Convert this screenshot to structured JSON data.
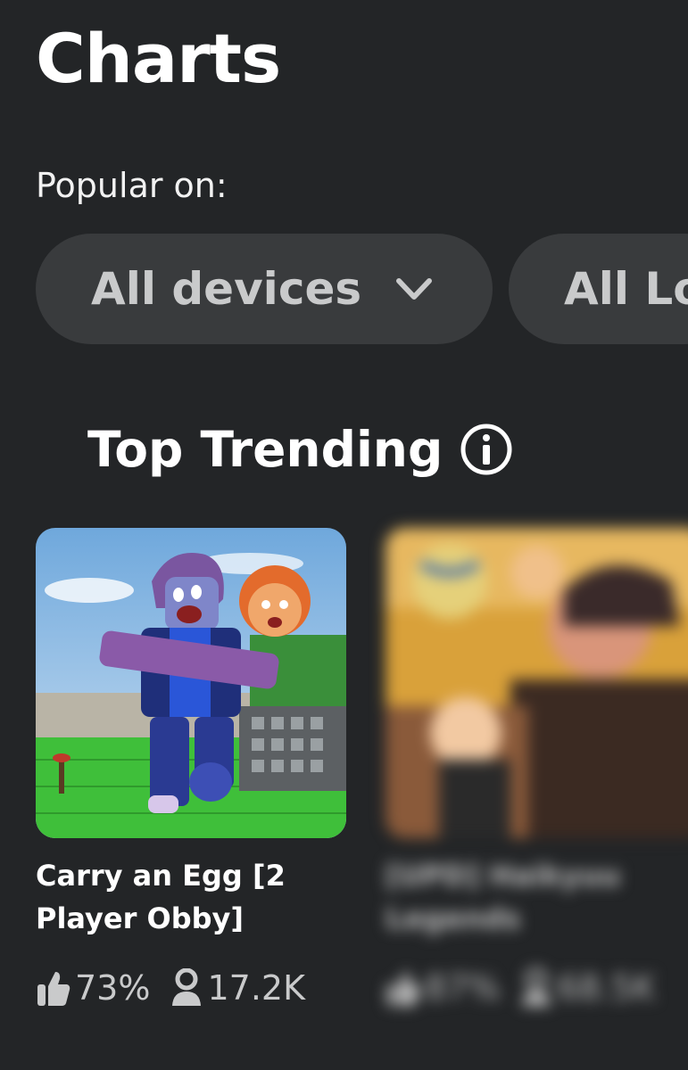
{
  "header": {
    "title": "Charts",
    "popular_label": "Popular on:"
  },
  "filters": {
    "devices_label": "All devices",
    "locations_label": "All Locations"
  },
  "section": {
    "title": "Top Trending"
  },
  "games": [
    {
      "name": "Carry an Egg [2 Player Obby]",
      "rating": "73%",
      "players": "17.2K"
    },
    {
      "name": "[UPD] Haikyuu Legends",
      "rating": "87%",
      "players": "68.5K"
    }
  ],
  "colors": {
    "background": "#232527",
    "chip": "#393b3d",
    "muted_text": "#c9cacb"
  }
}
